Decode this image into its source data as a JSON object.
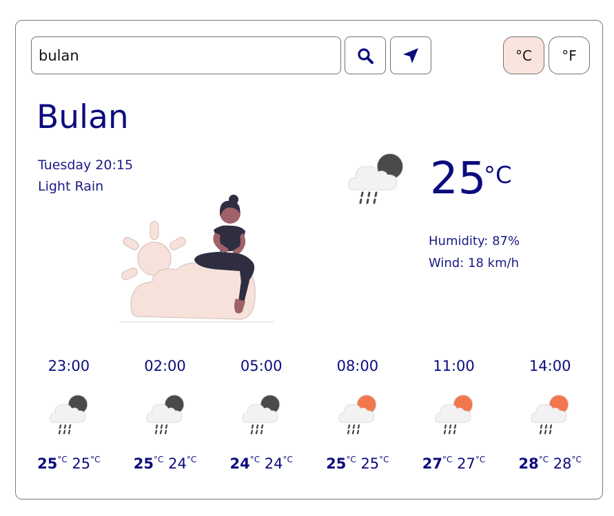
{
  "search": {
    "value": "bulan",
    "placeholder": ""
  },
  "units": {
    "celsius": "°C",
    "fahrenheit": "°F",
    "active": "celsius"
  },
  "current": {
    "city": "Bulan",
    "day_time": "Tuesday 20:15",
    "description": "Light Rain",
    "temperature": "25",
    "temperature_unit": "°C",
    "humidity": "Humidity: 87%",
    "wind": "Wind: 18 km/h",
    "icon": "night-cloud-rain-icon"
  },
  "forecast": [
    {
      "time": "23:00",
      "high": "25",
      "low": "25",
      "unit": "°C",
      "icon": "night-cloud-rain-icon"
    },
    {
      "time": "02:00",
      "high": "25",
      "low": "24",
      "unit": "°C",
      "icon": "night-cloud-rain-icon"
    },
    {
      "time": "05:00",
      "high": "24",
      "low": "24",
      "unit": "°C",
      "icon": "night-cloud-rain-icon"
    },
    {
      "time": "08:00",
      "high": "25",
      "low": "25",
      "unit": "°C",
      "icon": "sun-cloud-rain-icon"
    },
    {
      "time": "11:00",
      "high": "27",
      "low": "27",
      "unit": "°C",
      "icon": "sun-cloud-rain-icon"
    },
    {
      "time": "14:00",
      "high": "28",
      "low": "28",
      "unit": "°C",
      "icon": "sun-cloud-rain-icon"
    }
  ],
  "colors": {
    "accent": "#0b0b7e",
    "moon": "#4a4a4a",
    "sun": "#f2774e",
    "toggle_active": "#f9e4dd"
  }
}
